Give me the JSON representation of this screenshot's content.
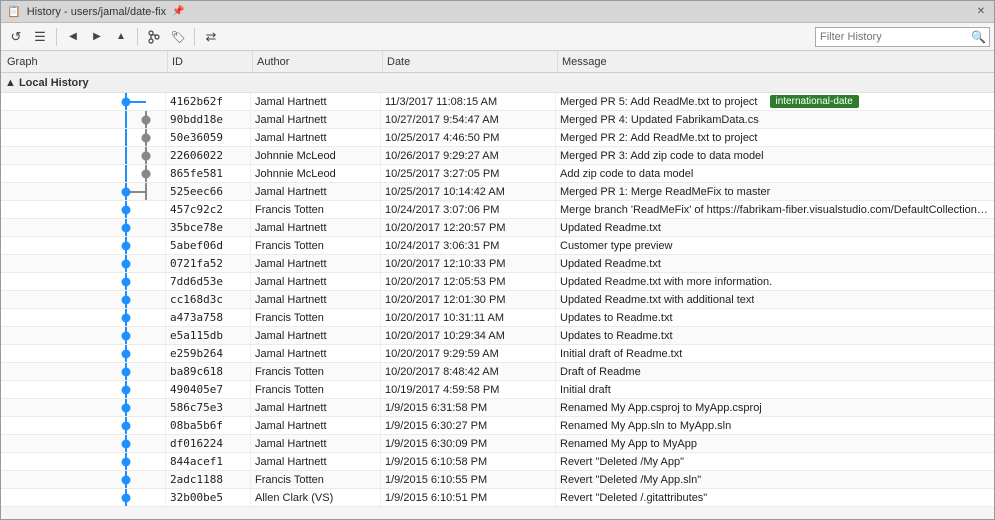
{
  "window": {
    "title": "History - users/jamal/date-fix",
    "tab_icon": "📄"
  },
  "toolbar": {
    "filter_placeholder": "Filter History",
    "buttons": [
      {
        "name": "refresh",
        "icon": "↺",
        "label": "Refresh"
      },
      {
        "name": "list",
        "icon": "☰",
        "label": "Show as list"
      },
      {
        "name": "nav-back",
        "icon": "◀",
        "label": "Back"
      },
      {
        "name": "nav-forward",
        "icon": "▶",
        "label": "Forward"
      },
      {
        "name": "nav-up",
        "icon": "▲",
        "label": "Up"
      },
      {
        "name": "sep1"
      },
      {
        "name": "branch",
        "icon": "⎇",
        "label": "Branch"
      },
      {
        "name": "tag",
        "icon": "🏷",
        "label": "Tag"
      },
      {
        "name": "sep2"
      },
      {
        "name": "compare",
        "icon": "⇄",
        "label": "Compare"
      }
    ]
  },
  "columns": {
    "graph": "Graph",
    "id": "ID",
    "author": "Author",
    "date": "Date",
    "message": "Message"
  },
  "section": {
    "label": "▲ Local History"
  },
  "rows": [
    {
      "id": "4162b62f",
      "author": "Jamal Hartnett",
      "date": "11/3/2017 11:08:15 AM",
      "message": "Merged PR 5: Add ReadMe.txt to project",
      "badge": "international-date"
    },
    {
      "id": "90bdd18e",
      "author": "Jamal Hartnett",
      "date": "10/27/2017 9:54:47 AM",
      "message": "Merged PR 4: Updated FabrikamData.cs",
      "badge": ""
    },
    {
      "id": "50e36059",
      "author": "Jamal Hartnett",
      "date": "10/25/2017 4:46:50 PM",
      "message": "Merged PR 2: Add ReadMe.txt to project",
      "badge": ""
    },
    {
      "id": "22606022",
      "author": "Johnnie McLeod",
      "date": "10/26/2017 9:29:27 AM",
      "message": "Merged PR 3: Add zip code to data model",
      "badge": ""
    },
    {
      "id": "865fe581",
      "author": "Johnnie McLeod",
      "date": "10/25/2017 3:27:05 PM",
      "message": "Add zip code to data model",
      "badge": ""
    },
    {
      "id": "525eec66",
      "author": "Jamal Hartnett",
      "date": "10/25/2017 10:14:42 AM",
      "message": "Merged PR 1: Merge ReadMeFix to master",
      "badge": ""
    },
    {
      "id": "457c92c2",
      "author": "Francis Totten",
      "date": "10/24/2017 3:07:06 PM",
      "message": "Merge branch 'ReadMeFix' of https://fabrikam-fiber.visualstudio.com/DefaultCollection/_git/...",
      "badge": ""
    },
    {
      "id": "35bce78e",
      "author": "Jamal Hartnett",
      "date": "10/20/2017 12:20:57 PM",
      "message": "Updated Readme.txt",
      "badge": ""
    },
    {
      "id": "5abef06d",
      "author": "Francis Totten",
      "date": "10/24/2017 3:06:31 PM",
      "message": "Customer type preview",
      "badge": ""
    },
    {
      "id": "0721fa52",
      "author": "Jamal Hartnett",
      "date": "10/20/2017 12:10:33 PM",
      "message": "Updated Readme.txt",
      "badge": ""
    },
    {
      "id": "7dd6d53e",
      "author": "Jamal Hartnett",
      "date": "10/20/2017 12:05:53 PM",
      "message": "Updated Readme.txt with more information.",
      "badge": ""
    },
    {
      "id": "cc168d3c",
      "author": "Jamal Hartnett",
      "date": "10/20/2017 12:01:30 PM",
      "message": "Updated Readme.txt with additional text",
      "badge": ""
    },
    {
      "id": "a473a758",
      "author": "Francis Totten",
      "date": "10/20/2017 10:31:11 AM",
      "message": "Updates to Readme.txt",
      "badge": ""
    },
    {
      "id": "e5a115db",
      "author": "Jamal Hartnett",
      "date": "10/20/2017 10:29:34 AM",
      "message": "Updates to Readme.txt",
      "badge": ""
    },
    {
      "id": "e259b264",
      "author": "Jamal Hartnett",
      "date": "10/20/2017 9:29:59 AM",
      "message": "Initial draft of Readme.txt",
      "badge": ""
    },
    {
      "id": "ba89c618",
      "author": "Francis Totten",
      "date": "10/20/2017 8:48:42 AM",
      "message": "Draft of Readme",
      "badge": ""
    },
    {
      "id": "490405e7",
      "author": "Francis Totten",
      "date": "10/19/2017 4:59:58 PM",
      "message": "Initial draft",
      "badge": ""
    },
    {
      "id": "586c75e3",
      "author": "Jamal Hartnett",
      "date": "1/9/2015 6:31:58 PM",
      "message": "Renamed My App.csproj to MyApp.csproj",
      "badge": ""
    },
    {
      "id": "08ba5b6f",
      "author": "Jamal Hartnett",
      "date": "1/9/2015 6:30:27 PM",
      "message": "Renamed My App.sln to MyApp.sln",
      "badge": ""
    },
    {
      "id": "df016224",
      "author": "Jamal Hartnett",
      "date": "1/9/2015 6:30:09 PM",
      "message": "Renamed My App to MyApp",
      "badge": ""
    },
    {
      "id": "844acef1",
      "author": "Jamal Hartnett",
      "date": "1/9/2015 6:10:58 PM",
      "message": "Revert \"Deleted /My App\"",
      "badge": ""
    },
    {
      "id": "2adc1188",
      "author": "Francis Totten",
      "date": "1/9/2015 6:10:55 PM",
      "message": "Revert \"Deleted /My App.sln\"",
      "badge": ""
    },
    {
      "id": "32b00be5",
      "author": "Allen Clark (VS)",
      "date": "1/9/2015 6:10:51 PM",
      "message": "Revert \"Deleted /.gitattributes\"",
      "badge": ""
    }
  ],
  "colors": {
    "badge_bg": "#2d7d2d",
    "dot": "#1e90ff",
    "line": "#1e90ff"
  }
}
